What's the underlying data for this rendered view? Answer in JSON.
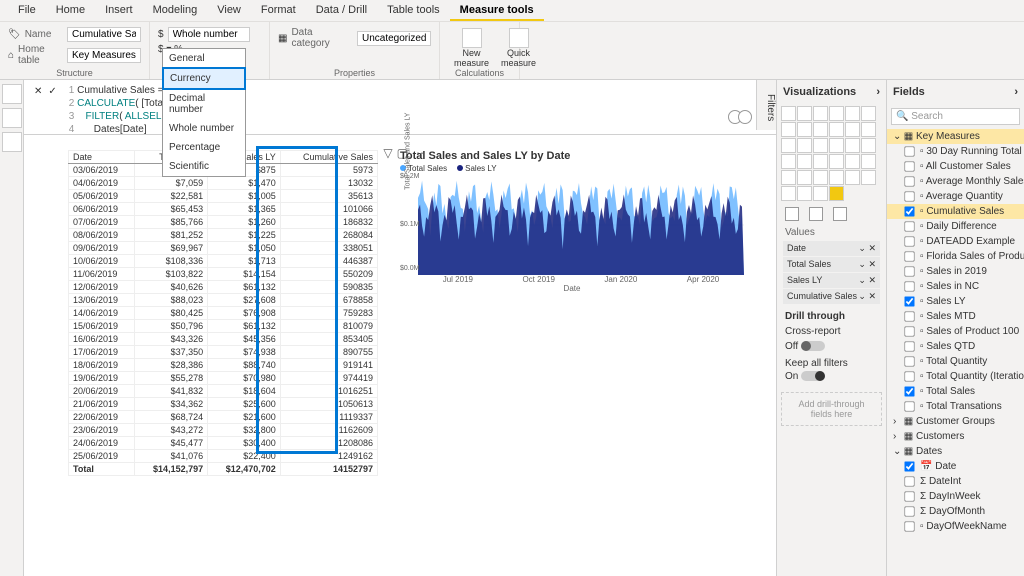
{
  "menubar": [
    "File",
    "Home",
    "Insert",
    "Modeling",
    "View",
    "Format",
    "Data / Drill",
    "Table tools",
    "Measure tools"
  ],
  "menubar_active": 8,
  "ribbon": {
    "name_label": "Name",
    "name_value": "Cumulative Sales",
    "home_table_label": "Home table",
    "home_table_value": "Key Measures",
    "structure_group": "Structure",
    "format_label": "Whole number",
    "data_category_label": "Data category",
    "data_category_value": "Uncategorized",
    "properties_group": "Properties",
    "new_measure": "New measure",
    "quick_measure": "Quick measure",
    "calculations_group": "Calculations"
  },
  "format_dropdown": [
    "General",
    "Currency",
    "Decimal number",
    "Whole number",
    "Percentage",
    "Scientific"
  ],
  "format_dropdown_hover": 1,
  "formula": {
    "line1": "Cumulative Sales =",
    "line2": "CALCULATE( [Total Sa",
    "line3": "   FILTER( ALLSELEC",
    "line4": "      Dates[Date]            ] ) )"
  },
  "table": {
    "headers": [
      "Date",
      "Total Sales",
      "Sales LY",
      "Cumulative Sales"
    ],
    "rows": [
      [
        "03/06/2019",
        "$5,973",
        "$875",
        "5973"
      ],
      [
        "04/06/2019",
        "$7,059",
        "$1,470",
        "13032"
      ],
      [
        "05/06/2019",
        "$22,581",
        "$1,005",
        "35613"
      ],
      [
        "06/06/2019",
        "$65,453",
        "$1,365",
        "101066"
      ],
      [
        "07/06/2019",
        "$85,766",
        "$1,260",
        "186832"
      ],
      [
        "08/06/2019",
        "$81,252",
        "$1,225",
        "268084"
      ],
      [
        "09/06/2019",
        "$69,967",
        "$1,050",
        "338051"
      ],
      [
        "10/06/2019",
        "$108,336",
        "$1,713",
        "446387"
      ],
      [
        "11/06/2019",
        "$103,822",
        "$14,154",
        "550209"
      ],
      [
        "12/06/2019",
        "$40,626",
        "$61,132",
        "590835"
      ],
      [
        "13/06/2019",
        "$88,023",
        "$27,608",
        "678858"
      ],
      [
        "14/06/2019",
        "$80,425",
        "$76,908",
        "759283"
      ],
      [
        "15/06/2019",
        "$50,796",
        "$61,132",
        "810079"
      ],
      [
        "16/06/2019",
        "$43,326",
        "$45,356",
        "853405"
      ],
      [
        "17/06/2019",
        "$37,350",
        "$74,938",
        "890755"
      ],
      [
        "18/06/2019",
        "$28,386",
        "$88,740",
        "919141"
      ],
      [
        "19/06/2019",
        "$55,278",
        "$70,980",
        "974419"
      ],
      [
        "20/06/2019",
        "$41,832",
        "$18,604",
        "1016251"
      ],
      [
        "21/06/2019",
        "$34,362",
        "$25,600",
        "1050613"
      ],
      [
        "22/06/2019",
        "$68,724",
        "$21,600",
        "1119337"
      ],
      [
        "23/06/2019",
        "$43,272",
        "$32,800",
        "1162609"
      ],
      [
        "24/06/2019",
        "$45,477",
        "$30,400",
        "1208086"
      ],
      [
        "25/06/2019",
        "$41,076",
        "$22,400",
        "1249162"
      ]
    ],
    "total_row": [
      "Total",
      "$14,152,797",
      "$12,470,702",
      "14152797"
    ]
  },
  "chart_data": {
    "type": "area",
    "title": "Total Sales and Sales LY by Date",
    "series": [
      {
        "name": "Total Sales",
        "color": "#4aa6ff"
      },
      {
        "name": "Sales LY",
        "color": "#1a237e"
      }
    ],
    "ylabel": "Total Sales and Sales LY",
    "xlabel": "Date",
    "ylim": [
      0,
      200000
    ],
    "yticks": [
      "$0.0M",
      "$0.1M",
      "$0.2M"
    ],
    "xticks": [
      "Jul 2019",
      "Oct 2019",
      "Jan 2020",
      "Apr 2020"
    ],
    "note": "Dense daily series ~Jun 2019 – May 2020; values roughly 0–$0.2M per day for both series"
  },
  "viz_pane": {
    "title": "Visualizations",
    "values_label": "Values",
    "wells": [
      "Date",
      "Total Sales",
      "Sales LY",
      "Cumulative Sales"
    ],
    "drill_title": "Drill through",
    "cross_report": "Cross-report",
    "cross_report_state": "Off",
    "keep_filters": "Keep all filters",
    "keep_filters_state": "On",
    "drop_hint": "Add drill-through fields here"
  },
  "fields_pane": {
    "title": "Fields",
    "search_placeholder": "Search",
    "tables": [
      {
        "name": "Key Measures",
        "expanded": true,
        "highlighted": true,
        "fields": [
          {
            "name": "30 Day Running Total",
            "checked": false
          },
          {
            "name": "All Customer Sales",
            "checked": false
          },
          {
            "name": "Average Monthly Sales",
            "checked": false
          },
          {
            "name": "Average Quantity",
            "checked": false
          },
          {
            "name": "Cumulative Sales",
            "checked": true,
            "highlighted": true
          },
          {
            "name": "Daily Difference",
            "checked": false
          },
          {
            "name": "DATEADD Example",
            "checked": false
          },
          {
            "name": "Florida Sales of Product ...",
            "checked": false
          },
          {
            "name": "Sales in 2019",
            "checked": false
          },
          {
            "name": "Sales in NC",
            "checked": false
          },
          {
            "name": "Sales LY",
            "checked": true
          },
          {
            "name": "Sales MTD",
            "checked": false
          },
          {
            "name": "Sales of Product 100",
            "checked": false
          },
          {
            "name": "Sales QTD",
            "checked": false
          },
          {
            "name": "Total Quantity",
            "checked": false
          },
          {
            "name": "Total Quantity (Iteration)",
            "checked": false
          },
          {
            "name": "Total Sales",
            "checked": true
          },
          {
            "name": "Total Transations",
            "checked": false
          }
        ]
      },
      {
        "name": "Customer Groups",
        "expanded": false
      },
      {
        "name": "Customers",
        "expanded": false
      },
      {
        "name": "Dates",
        "expanded": true,
        "fields": [
          {
            "name": "Date",
            "checked": true,
            "icon": "calendar"
          },
          {
            "name": "DateInt",
            "checked": false,
            "icon": "sigma"
          },
          {
            "name": "DayInWeek",
            "checked": false,
            "icon": "sigma"
          },
          {
            "name": "DayOfMonth",
            "checked": false,
            "icon": "sigma"
          },
          {
            "name": "DayOfWeekName",
            "checked": false
          }
        ]
      }
    ]
  },
  "filters_label": "Filters"
}
